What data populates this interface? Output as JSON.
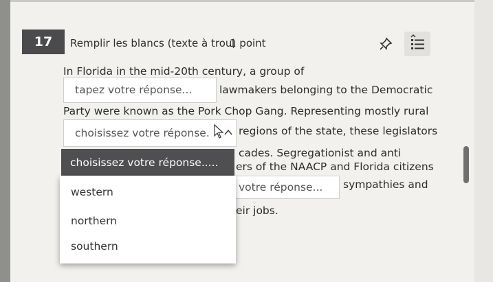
{
  "question": {
    "number": "17",
    "type": "Remplir les blancs (texte à trou)",
    "points": "1 point"
  },
  "icons": {
    "pin": "pin-icon",
    "list": "list-icon",
    "cursor": "cursor-icon"
  },
  "passage": {
    "line1": "In Florida in the mid-20th century, a group of",
    "blank1_placeholder": "tapez votre réponse...",
    "line2_after": "lawmakers belonging to the Democratic",
    "line3": "Party were known as the Pork Chop Gang. Representing mostly rural",
    "dropdown1_placeholder": "choisissez votre réponse.",
    "line4_after": "regions of the state, these legislators",
    "line5_right": "cades. Segregationist and anti",
    "line6_right": "ers of the NAACP and Florida citizens",
    "blank3_placeholder": "votre réponse...",
    "line7_after": "sympathies and",
    "line8_right": "eir jobs."
  },
  "dropdown2": {
    "selected_label": "choisissez votre réponse.....",
    "options": [
      "western",
      "northern",
      "southern"
    ]
  }
}
